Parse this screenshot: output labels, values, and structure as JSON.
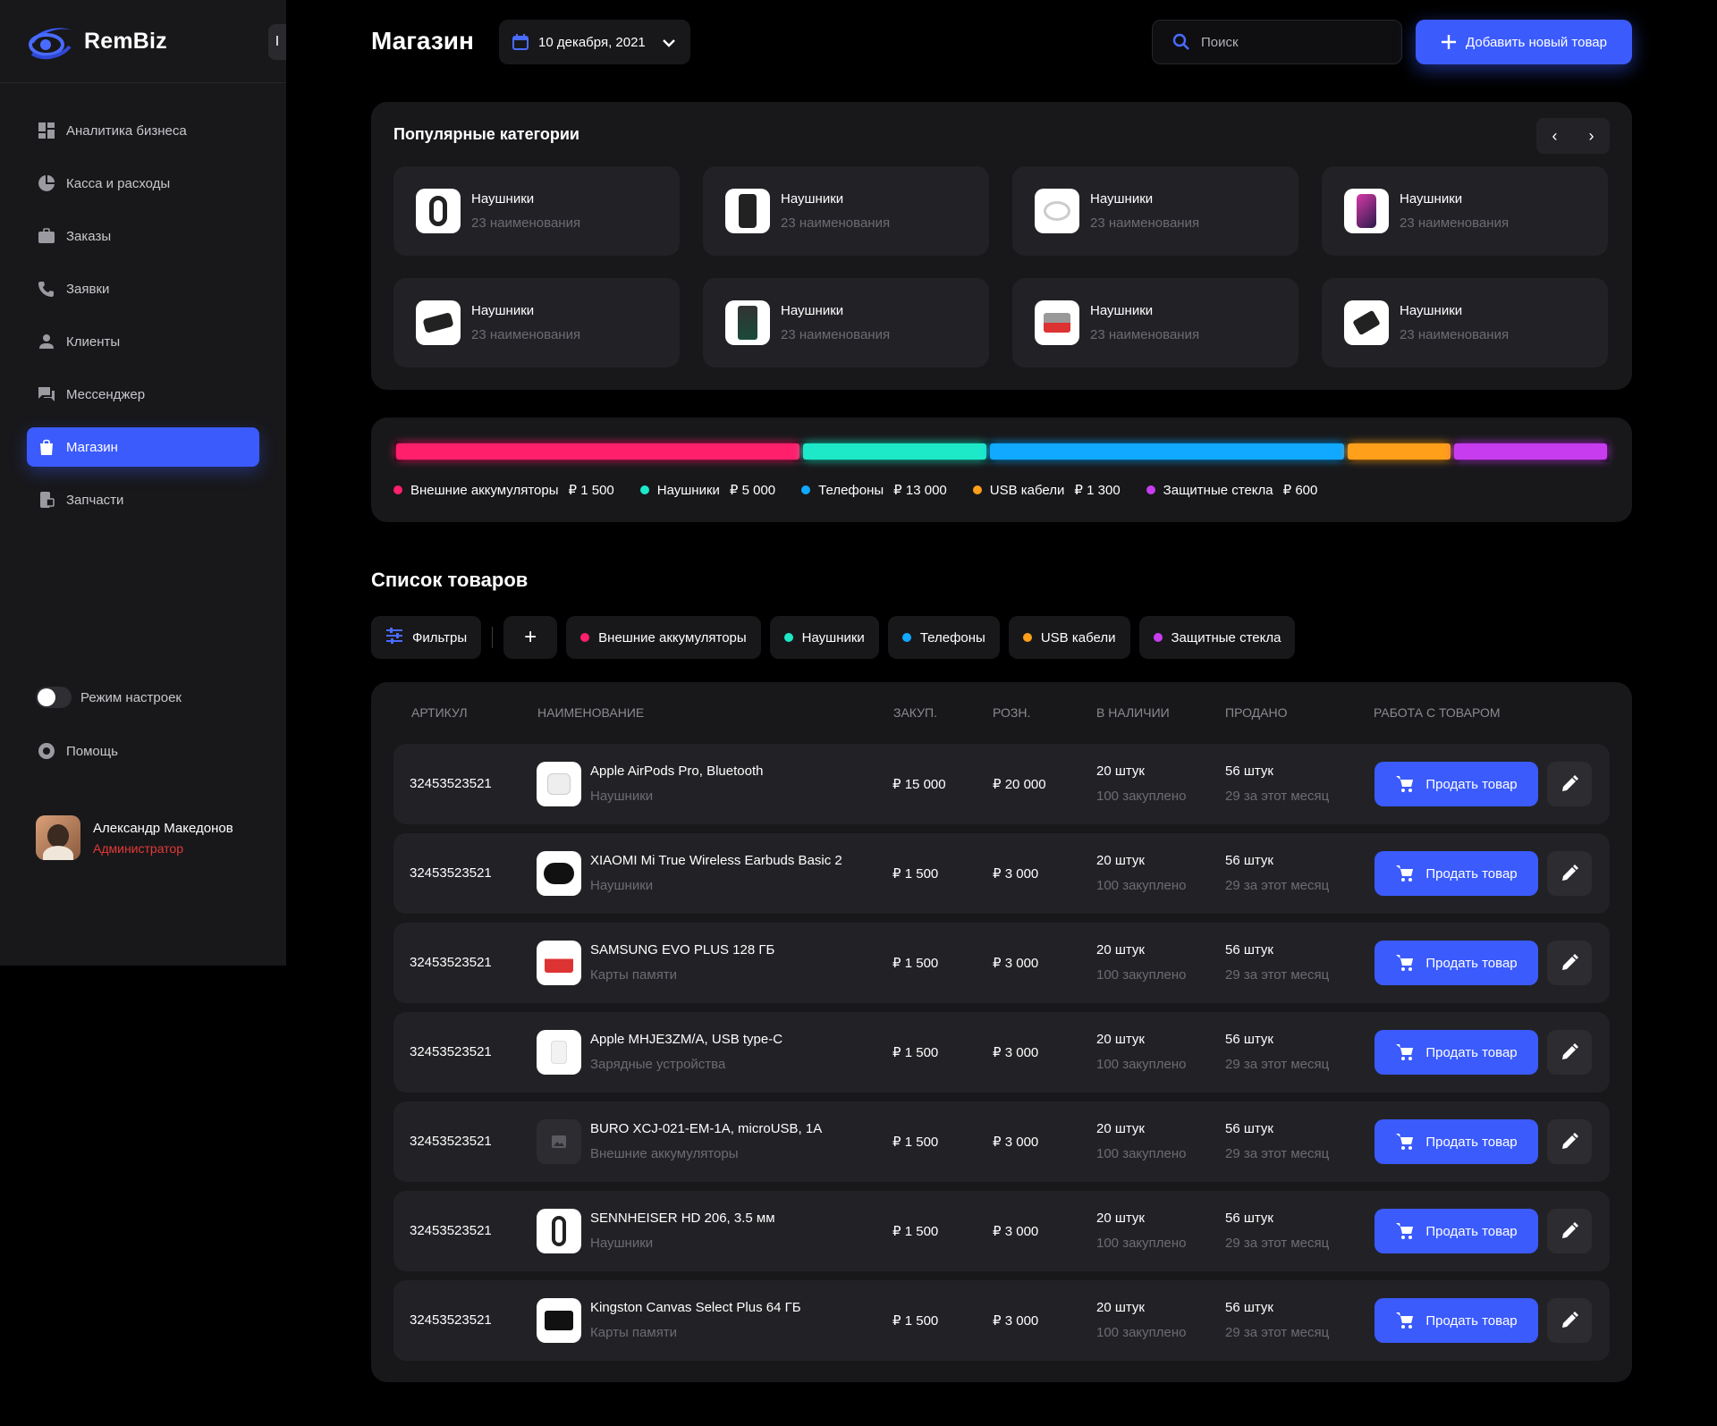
{
  "app": {
    "name": "RemBiz",
    "collapse_label": "I"
  },
  "sidebar": {
    "items": [
      {
        "label": "Аналитика бизнеса",
        "icon": "dashboard-icon",
        "active": false
      },
      {
        "label": "Касса и расходы",
        "icon": "pie-chart-icon",
        "active": false
      },
      {
        "label": "Заказы",
        "icon": "briefcase-icon",
        "active": false
      },
      {
        "label": "Заявки",
        "icon": "phone-icon",
        "active": false
      },
      {
        "label": "Клиенты",
        "icon": "user-icon",
        "active": false
      },
      {
        "label": "Мессенджер",
        "icon": "chat-icon",
        "active": false
      },
      {
        "label": "Магазин",
        "icon": "shopping-bag-icon",
        "active": true
      },
      {
        "label": "Запчасти",
        "icon": "parts-icon",
        "active": false
      }
    ],
    "settings_mode": "Режим настроек",
    "help": "Помощь",
    "user": {
      "name": "Александр Македонов",
      "role": "Администратор"
    }
  },
  "header": {
    "title": "Магазин",
    "date": "10 декабря, 2021",
    "search_placeholder": "Поиск",
    "add_button": "Добавить новый товар"
  },
  "categories": {
    "title": "Популярные категории",
    "items": [
      {
        "name": "Наушники",
        "count": "23 наименования"
      },
      {
        "name": "Наушники",
        "count": "23 наименования"
      },
      {
        "name": "Наушники",
        "count": "23 наименования"
      },
      {
        "name": "Наушники",
        "count": "23 наименования"
      },
      {
        "name": "Наушники",
        "count": "23 наименования"
      },
      {
        "name": "Наушники",
        "count": "23 наименования"
      },
      {
        "name": "Наушники",
        "count": "23 наименования"
      },
      {
        "name": "Наушники",
        "count": "23 наименования"
      }
    ]
  },
  "sales": {
    "segments": [
      {
        "label": "Внешние аккумуляторы",
        "value": "₽ 1 500",
        "color": "#ff1f6b",
        "share": 0.337
      },
      {
        "label": "Наушники",
        "value": "₽ 5 000",
        "color": "#1de9c9",
        "share": 0.153
      },
      {
        "label": "Телефоны",
        "value": "₽ 13 000",
        "color": "#11a8ff",
        "share": 0.296
      },
      {
        "label": "USB кабели",
        "value": "₽ 1 300",
        "color": "#ff9f1a",
        "share": 0.086
      },
      {
        "label": "Защитные стекла",
        "value": "₽ 600",
        "color": "#c83cf0",
        "share": 0.128
      }
    ]
  },
  "product_list": {
    "title": "Список товаров",
    "filters_label": "Фильтры",
    "add_filter": "+",
    "filter_chips": [
      {
        "label": "Внешние аккумуляторы",
        "color": "#ff1f6b"
      },
      {
        "label": "Наушники",
        "color": "#1de9c9"
      },
      {
        "label": "Телефоны",
        "color": "#11a8ff"
      },
      {
        "label": "USB кабели",
        "color": "#ff9f1a"
      },
      {
        "label": "Защитные стекла",
        "color": "#c83cf0"
      }
    ],
    "columns": [
      "Артикул",
      "Наименование",
      "Закуп.",
      "Розн.",
      "В наличии",
      "Продано",
      "Работа с товаром"
    ],
    "sell_label": "Продать товар",
    "rows": [
      {
        "article": "32453523521",
        "name": "Apple AirPods Pro, Bluetooth",
        "category": "Наушники",
        "buy": "₽ 15 000",
        "retail": "₽ 20 000",
        "stock": "20 штук",
        "stock_note": "100 закуплено",
        "sold": "56 штук",
        "sold_note": "29 за этот месяц"
      },
      {
        "article": "32453523521",
        "name": "XIAOMI Mi True Wireless Earbuds Basic 2",
        "category": "Наушники",
        "buy": "₽ 1 500",
        "retail": "₽ 3 000",
        "stock": "20 штук",
        "stock_note": "100 закуплено",
        "sold": "56 штук",
        "sold_note": "29 за этот месяц"
      },
      {
        "article": "32453523521",
        "name": "SAMSUNG EVO PLUS 128 ГБ",
        "category": "Карты памяти",
        "buy": "₽ 1 500",
        "retail": "₽ 3 000",
        "stock": "20 штук",
        "stock_note": "100 закуплено",
        "sold": "56 штук",
        "sold_note": "29 за этот месяц"
      },
      {
        "article": "32453523521",
        "name": "Apple MHJE3ZM/A, USB type-C",
        "category": "Зарядные устройства",
        "buy": "₽ 1 500",
        "retail": "₽ 3 000",
        "stock": "20 штук",
        "stock_note": "100 закуплено",
        "sold": "56 штук",
        "sold_note": "29 за этот месяц"
      },
      {
        "article": "32453523521",
        "name": "BURO XCJ-021-EM-1A, microUSB, 1A",
        "category": "Внешние аккумуляторы",
        "buy": "₽ 1 500",
        "retail": "₽ 3 000",
        "stock": "20 штук",
        "stock_note": "100 закуплено",
        "sold": "56 штук",
        "sold_note": "29 за этот месяц"
      },
      {
        "article": "32453523521",
        "name": "SENNHEISER HD 206, 3.5 мм",
        "category": "Наушники",
        "buy": "₽ 1 500",
        "retail": "₽ 3 000",
        "stock": "20 штук",
        "stock_note": "100 закуплено",
        "sold": "56 штук",
        "sold_note": "29 за этот месяц"
      },
      {
        "article": "32453523521",
        "name": "Kingston Canvas Select Plus 64 ГБ",
        "category": "Карты памяти",
        "buy": "₽ 1 500",
        "retail": "₽ 3 000",
        "stock": "20 штук",
        "stock_note": "100 закуплено",
        "sold": "56 штук",
        "sold_note": "29 за этот месяц"
      }
    ]
  }
}
